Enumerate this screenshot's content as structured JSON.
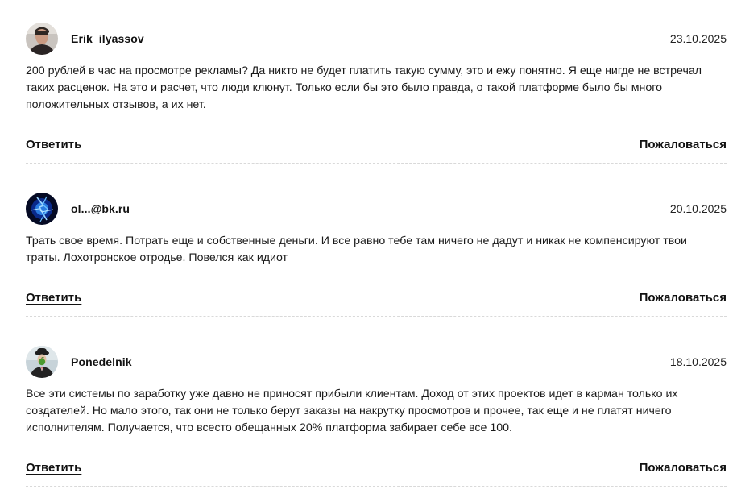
{
  "comments": [
    {
      "author": "Erik_ilyassov",
      "date": "23.10.2025",
      "avatar_icon": "user-photo-avatar",
      "text": "200 рублей в час на просмотре рекламы? Да никто не будет платить такую сумму, это и ежу понятно. Я еще нигде не встречал таких расценок. На это и расчет, что люди клюнут. Только если бы это было правда, о такой платформе было бы много положительных отзывов, а их нет.",
      "reply_label": "Ответить",
      "report_label": "Пожаловаться"
    },
    {
      "author": "ol...@bk.ru",
      "date": "20.10.2025",
      "avatar_icon": "blue-lightning-avatar",
      "text": "Трать свое время. Потрать еще и собственные деньги. И все равно тебе там ничего не дадут и никак не компенсируют твои траты. Лохотронское отродье. Повелся как идиот",
      "reply_label": "Ответить",
      "report_label": "Пожаловаться"
    },
    {
      "author": "Ponedelnik",
      "date": "18.10.2025",
      "avatar_icon": "bowler-hat-man-avatar",
      "text": "Все эти системы по заработку уже давно не приносят прибыли клиентам. Доход от этих проектов идет в карман только их создателей. Но мало этого, так они не только берут заказы на накрутку просмотров и прочее, так еще и не платят ничего исполнителям. Получается, что всесто обещанных 20% платформа забирает себе все 100.",
      "reply_label": "Ответить",
      "report_label": "Пожаловаться"
    }
  ]
}
